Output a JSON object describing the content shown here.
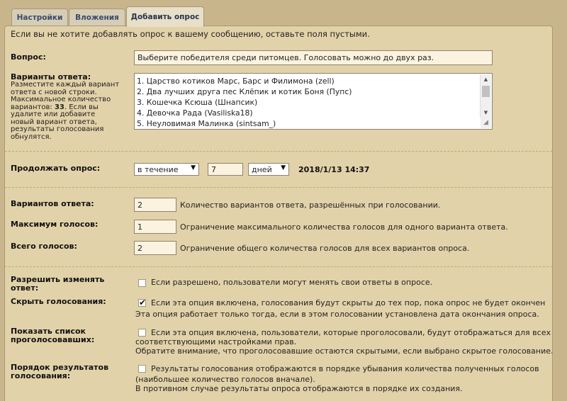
{
  "tabs": [
    {
      "label": "Настройки"
    },
    {
      "label": "Вложения"
    },
    {
      "label": "Добавить опрос"
    }
  ],
  "intro": "Если вы не хотите добавлять опрос к вашему сообщению, оставьте поля пустыми.",
  "question": {
    "label": "Вопрос:",
    "value": "Выберите победителя среди питомцев. Голосовать можно до двух раз."
  },
  "options": {
    "label": "Варианты ответа:",
    "hint": [
      "Разместите каждый вариант",
      "ответа с новой строки.",
      "Максимальное количество",
      "вариантов:",
      "33",
      ". Если вы",
      "удалите или добавите",
      "новый вариант ответа,",
      "результаты голосования",
      "обнулятся."
    ],
    "lines": [
      "1. Царство котиков Марс, Барс и Филимона (zell)",
      "2. Два лучших друга пес Клёпик и котик Боня (Пупс)",
      "3. Кошечка Ксюша (Шнапсик)",
      "4. Девочка Рада (Vasiliska18)",
      "5. Неуловимая Малинка (sintsam_)"
    ]
  },
  "duration": {
    "label": "Продолжать опрос:",
    "mode": "в течение",
    "amount": "7",
    "unit": "дней",
    "end_date": "2018/1/13 14:37"
  },
  "limits": [
    {
      "label": "Вариантов ответа:",
      "value": "2",
      "desc": "Количество вариантов ответа, разрешённых при голосовании."
    },
    {
      "label": "Максимум голосов:",
      "value": "1",
      "desc": "Ограничение максимального количества голосов для одного варианта ответа."
    },
    {
      "label": "Всего голосов:",
      "value": "2",
      "desc": "Ограничение общего количества голосов для всех вариантов опроса."
    }
  ],
  "settings": [
    {
      "label": [
        "Разрешить изменять",
        "ответ:"
      ],
      "checked": false,
      "check_mark": "",
      "desc": [
        "Если разрешено, пользователи могут менять свои ответы в опросе."
      ]
    },
    {
      "label": [
        "Скрыть голосования:"
      ],
      "checked": true,
      "check_mark": "✔",
      "desc": [
        "Если эта опция включена, голосования будут скрыты до тех пор, пока опрос не будет окончен",
        "Эта опция работает только тогда, если в этом голосовании установлена дата окончания опроса."
      ]
    },
    {
      "label": [
        "Показать список",
        "проголосовавших:"
      ],
      "checked": false,
      "check_mark": "",
      "desc": [
        "Если эта опция включена, пользователи, которые проголосовали, будут отображаться для всех с",
        "соответствующими настройками прав.",
        "Обратите внимание, что проголосовавшие остаются скрытыми, если выбрано скрытое голосование."
      ]
    },
    {
      "label": [
        "Порядок результатов",
        "голосования:"
      ],
      "checked": false,
      "check_mark": "",
      "desc": [
        "Результаты голосования отображаются в порядке убывания количества полученных голосов",
        "(наибольшее количество голосов вначале).",
        "В противном случае результаты опроса отображаются в порядке их создания."
      ]
    }
  ]
}
